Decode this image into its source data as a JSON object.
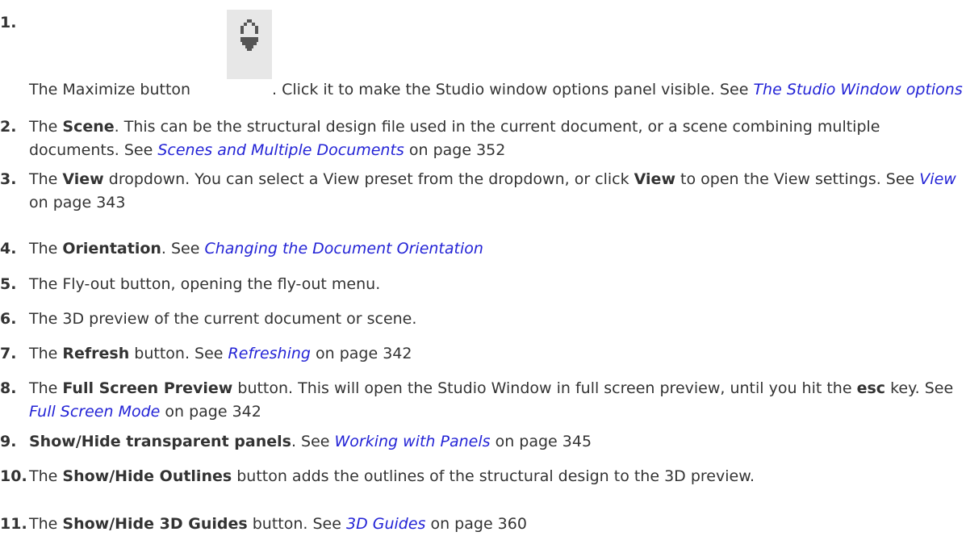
{
  "items": [
    {
      "num": "1.",
      "pre": "The Maximize button",
      "icon": "maximize-restore-icon",
      "post": ". Click it to make the Studio window options panel visible. See ",
      "link": "The Studio Window options panel"
    },
    {
      "num": "2.",
      "pre": "The ",
      "bold": "Scene",
      "mid": ". This can be the structural design file used in the current document, or a scene combining multiple documents. See ",
      "link": "Scenes and Multiple Documents",
      "page": " on page 352"
    },
    {
      "num": "3.",
      "pre": "The ",
      "bold": "View",
      "mid": " dropdown. You can select a View preset from the dropdown, or click ",
      "bold2": "View",
      "mid2": " to open the View settings. See ",
      "link": "View",
      "page": " on page 343"
    },
    {
      "num": "4.",
      "pre": "The ",
      "bold": "Orientation",
      "mid": ". See ",
      "link": "Changing the Document Orientation"
    },
    {
      "num": "5.",
      "text": "The Fly-out button, opening the fly-out menu."
    },
    {
      "num": "6.",
      "text": "The 3D preview of the current document or scene."
    },
    {
      "num": "7.",
      "pre": "The ",
      "bold": "Refresh",
      "mid": " button. See ",
      "link": "Refreshing",
      "page": " on page 342"
    },
    {
      "num": "8.",
      "pre": "The ",
      "bold": "Full Screen Preview",
      "mid": " button. This will open the Studio Window in full screen preview, until you hit the ",
      "bold2": "esc",
      "mid2": " key. See ",
      "link": "Full Screen Mode",
      "page": " on page 342"
    },
    {
      "num": "9.",
      "bold": "Show/Hide transparent panels",
      "mid": ". See ",
      "link": "Working with Panels",
      "page": " on page 345"
    },
    {
      "num": "10.",
      "pre": "The ",
      "bold": "Show/Hide Outlines",
      "mid": " button adds the outlines of the structural design to the 3D preview."
    },
    {
      "num": "11.",
      "pre": "The ",
      "bold": "Show/Hide 3D Guides",
      "mid": " button. See ",
      "link": "3D Guides",
      "page": " on page 360"
    }
  ]
}
